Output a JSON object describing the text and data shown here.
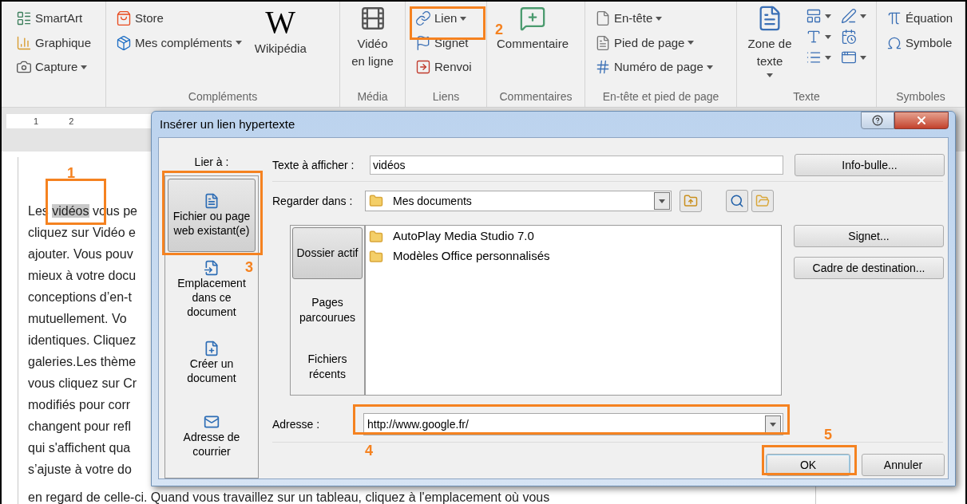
{
  "ribbon": {
    "groups": [
      {
        "items": [
          {
            "label": "SmartArt",
            "kind": "small",
            "dropdown": false
          },
          {
            "label": "Graphique",
            "kind": "small",
            "dropdown": false
          },
          {
            "label": "Capture",
            "kind": "small",
            "dropdown": true
          }
        ]
      },
      {
        "label": "Compléments",
        "items": [
          {
            "label": "Store",
            "kind": "small",
            "dropdown": false
          },
          {
            "label": "Mes compléments",
            "kind": "small",
            "dropdown": true
          },
          {
            "label": "Wikipédia",
            "kind": "logo",
            "logo": "W"
          }
        ]
      },
      {
        "label": "Média",
        "items": [
          {
            "label": "Vidéo en ligne",
            "kind": "large",
            "dropdown": false
          }
        ]
      },
      {
        "label": "Liens",
        "items": [
          {
            "label": "Lien",
            "kind": "small",
            "dropdown": true
          },
          {
            "label": "Signet",
            "kind": "small",
            "dropdown": false
          },
          {
            "label": "Renvoi",
            "kind": "small",
            "dropdown": false
          }
        ]
      },
      {
        "label": "Commentaires",
        "items": [
          {
            "label": "Commentaire",
            "kind": "large",
            "dropdown": false
          }
        ]
      },
      {
        "label": "En-tête et pied de page",
        "items": [
          {
            "label": "En-tête",
            "kind": "small",
            "dropdown": true
          },
          {
            "label": "Pied de page",
            "kind": "small",
            "dropdown": true
          },
          {
            "label": "Numéro de page",
            "kind": "small",
            "dropdown": true
          }
        ]
      },
      {
        "label": "Texte",
        "items": [
          {
            "label": "Zone de texte",
            "kind": "large",
            "dropdown": true
          },
          {
            "kind": "icon",
            "dropdown": true
          },
          {
            "kind": "icon",
            "dropdown": true
          },
          {
            "kind": "icon",
            "dropdown": true
          },
          {
            "kind": "icon",
            "dropdown": false
          },
          {
            "kind": "icon",
            "dropdown": true
          },
          {
            "kind": "icon",
            "dropdown": true
          }
        ]
      },
      {
        "label": "Symboles",
        "items": [
          {
            "label": "Équation",
            "kind": "small",
            "dropdown": false
          },
          {
            "label": "Symbole",
            "kind": "small",
            "dropdown": false
          }
        ]
      }
    ]
  },
  "ruler": {
    "labels": [
      "1",
      "2"
    ]
  },
  "document": {
    "lines": [
      {
        "before": "Les ",
        "highlight": "vidéos",
        "after": " vous pe"
      },
      {
        "before": "cliquez sur Vidéo e"
      },
      {
        "before": "ajouter. Vous pouv"
      },
      {
        "before": "mieux à votre docu"
      },
      {
        "before": "conceptions d’en-t"
      },
      {
        "before": "mutuellement. Vo"
      },
      {
        "before": "identiques. Cliquez"
      },
      {
        "before": "galeries.Les thème"
      },
      {
        "before": "vous cliquez sur Cr"
      },
      {
        "before": "modifiés pour corr"
      },
      {
        "before": "changent pour refl"
      },
      {
        "before": "qui s'affichent qua"
      },
      {
        "before": "s’ajuste à votre do"
      }
    ],
    "last_line": "en regard de celle-ci. Quand vous travaillez sur un tableau, cliquez à l'emplacement où vous"
  },
  "dialog": {
    "title": "Insérer un lien hypertexte",
    "link_to": {
      "label": "Lier à :",
      "options": [
        {
          "label": "Fichier ou page web existant(e)",
          "selected": true
        },
        {
          "label": "Emplacement dans ce document",
          "selected": false
        },
        {
          "label": "Créer un document",
          "selected": false
        },
        {
          "label": "Adresse de courrier",
          "selected": false
        }
      ]
    },
    "text_to_display": {
      "label": "Texte à afficher :",
      "value": "vidéos"
    },
    "tooltip_button": "Info-bulle...",
    "look_in": {
      "label": "Regarder dans :",
      "value": "Mes documents"
    },
    "places": [
      {
        "label": "Dossier actif",
        "selected": true
      },
      {
        "label": "Pages parcourues",
        "selected": false
      },
      {
        "label": "Fichiers récents",
        "selected": false
      }
    ],
    "files": [
      {
        "name": "AutoPlay Media Studio 7.0"
      },
      {
        "name": "Modèles Office personnalisés"
      }
    ],
    "bookmark_button": "Signet...",
    "target_frame_button": "Cadre de destination...",
    "address": {
      "label": "Adresse :",
      "value": "http://www.google.fr/"
    },
    "ok_button": "OK",
    "cancel_button": "Annuler"
  },
  "annotations": [
    {
      "label": "1"
    },
    {
      "label": "2"
    },
    {
      "label": "3"
    },
    {
      "label": "4"
    },
    {
      "label": "5"
    }
  ]
}
